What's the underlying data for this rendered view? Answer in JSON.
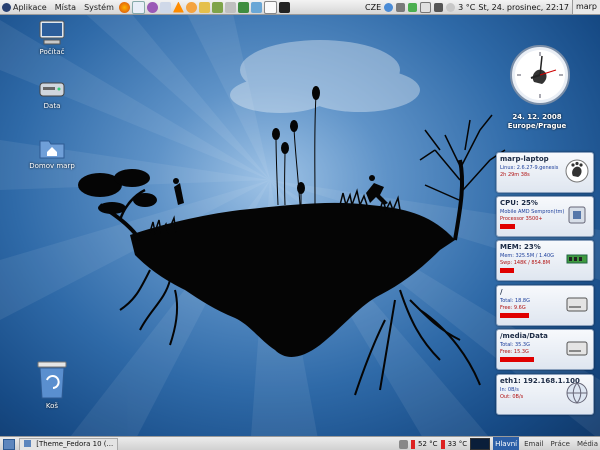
{
  "top_panel": {
    "menus": [
      "Aplikace",
      "Místa",
      "Systém"
    ],
    "keyboard_layout": "CZE",
    "weather": "3 °C",
    "datetime": "St, 24. prosinec, 22:17",
    "user": "marp"
  },
  "desktop_icons": [
    {
      "label": "Počítač",
      "icon": "computer-icon"
    },
    {
      "label": "Data",
      "icon": "drive-icon"
    },
    {
      "label": "Domov marp",
      "icon": "home-folder-icon"
    },
    {
      "label": "Koš",
      "icon": "trash-icon"
    }
  ],
  "clock": {
    "date": "24. 12. 2008",
    "timezone": "Europe/Prague"
  },
  "panels": [
    {
      "title": "marp-laptop",
      "line1": "Linux: 2.6.27-9.genesis",
      "line2": "2h 29m 38s",
      "bar": 0,
      "icon": "gnome-foot-icon"
    },
    {
      "title": "CPU: 25%",
      "line1": "Mobile AMD Sempron(tm)",
      "line2": "Processor 3500+",
      "bar": 0.25,
      "icon": "cpu-icon"
    },
    {
      "title": "MEM: 23%",
      "line1": "Mem: 325.5M / 1.40G",
      "line2": "Swp: 148K / 854.8M",
      "bar": 0.23,
      "icon": "memory-icon"
    },
    {
      "title": "/",
      "line1": "Total: 18.8G",
      "line2": "Free: 9.6G",
      "bar": 0.49,
      "icon": "harddisk-icon"
    },
    {
      "title": "/media/Data",
      "line1": "Total: 35.3G",
      "line2": "Free: 15.3G",
      "bar": 0.57,
      "icon": "harddisk-icon"
    },
    {
      "title": "eth1: 192.168.1.100",
      "line1": "In: 0B/s",
      "line2": "Out: 0B/s",
      "bar": 0,
      "icon": "network-icon"
    }
  ],
  "bottom_panel": {
    "task": "[Theme_Fedora 10 (...",
    "temp1": "52 °C",
    "temp2": "33 °C",
    "workspaces": [
      "Hlavní",
      "Email",
      "Práce",
      "Média"
    ],
    "active_workspace": "Hlavní"
  },
  "colors": {
    "accent": "#2c5fa7",
    "bar": "#e00000"
  }
}
